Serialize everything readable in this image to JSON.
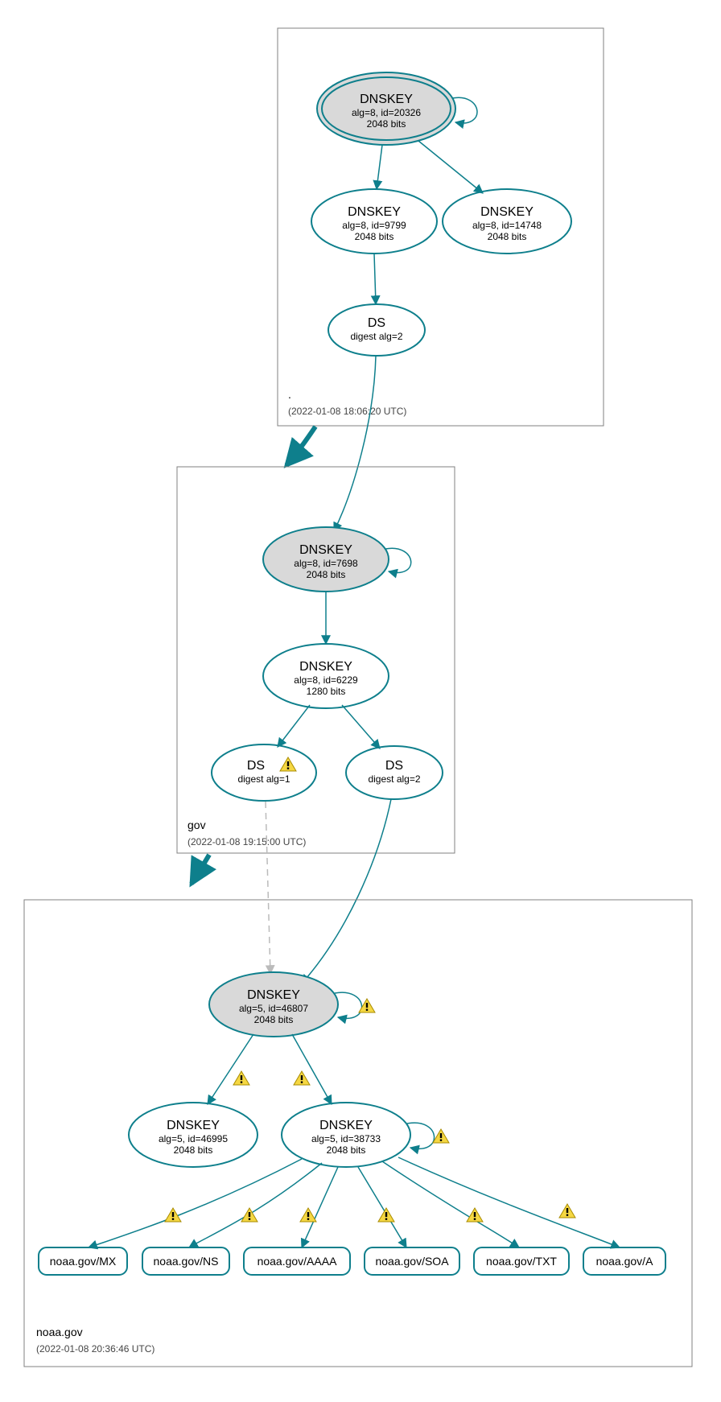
{
  "zones": {
    "root": {
      "label": ".",
      "time": "(2022-01-08 18:06:20 UTC)"
    },
    "gov": {
      "label": "gov",
      "time": "(2022-01-08 19:15:00 UTC)"
    },
    "noaa": {
      "label": "noaa.gov",
      "time": "(2022-01-08 20:36:46 UTC)"
    }
  },
  "nodes": {
    "root_ksk": {
      "title": "DNSKEY",
      "l2": "alg=8, id=20326",
      "l3": "2048 bits"
    },
    "root_zsk1": {
      "title": "DNSKEY",
      "l2": "alg=8, id=9799",
      "l3": "2048 bits"
    },
    "root_zsk2": {
      "title": "DNSKEY",
      "l2": "alg=8, id=14748",
      "l3": "2048 bits"
    },
    "root_ds": {
      "title": "DS",
      "l2": "digest alg=2"
    },
    "gov_ksk": {
      "title": "DNSKEY",
      "l2": "alg=8, id=7698",
      "l3": "2048 bits"
    },
    "gov_zsk": {
      "title": "DNSKEY",
      "l2": "alg=8, id=6229",
      "l3": "1280 bits"
    },
    "gov_ds1": {
      "title": "DS",
      "l2": "digest alg=1"
    },
    "gov_ds2": {
      "title": "DS",
      "l2": "digest alg=2"
    },
    "noaa_ksk": {
      "title": "DNSKEY",
      "l2": "alg=5, id=46807",
      "l3": "2048 bits"
    },
    "noaa_zsk1": {
      "title": "DNSKEY",
      "l2": "alg=5, id=46995",
      "l3": "2048 bits"
    },
    "noaa_zsk2": {
      "title": "DNSKEY",
      "l2": "alg=5, id=38733",
      "l3": "2048 bits"
    },
    "rr_mx": {
      "label": "noaa.gov/MX"
    },
    "rr_ns": {
      "label": "noaa.gov/NS"
    },
    "rr_aaaa": {
      "label": "noaa.gov/AAAA"
    },
    "rr_soa": {
      "label": "noaa.gov/SOA"
    },
    "rr_txt": {
      "label": "noaa.gov/TXT"
    },
    "rr_a": {
      "label": "noaa.gov/A"
    }
  }
}
